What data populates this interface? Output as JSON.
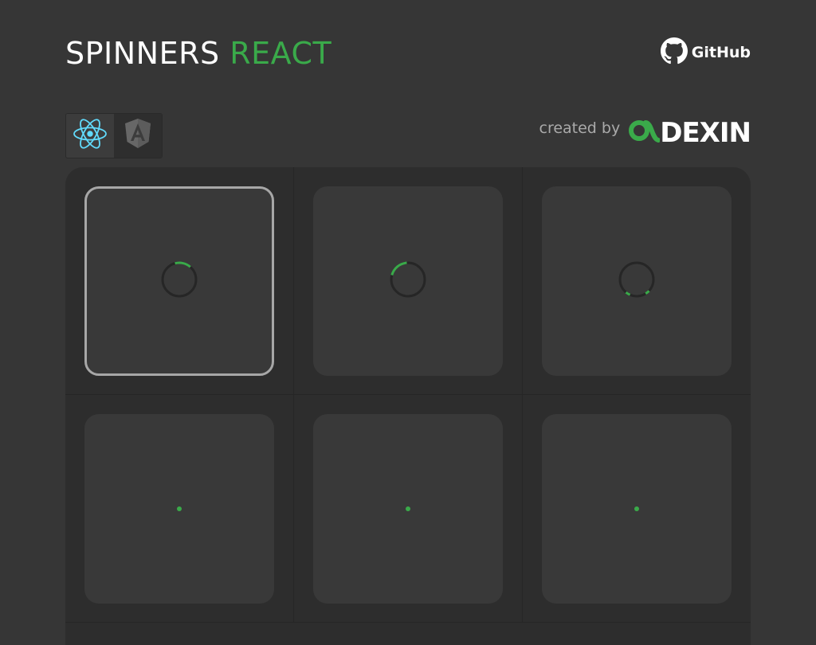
{
  "header": {
    "title_main": "SPINNERS",
    "title_accent": "REACT",
    "github_label": "GitHub"
  },
  "frameworks": [
    {
      "name": "React",
      "icon": "react-icon",
      "active": true
    },
    {
      "name": "Angular",
      "icon": "angular-icon",
      "active": false
    }
  ],
  "credit": {
    "label": "created by",
    "brand_text": "DEXIN"
  },
  "colors": {
    "background": "#363636",
    "accent": "#3aaa4a",
    "tile": "#393939",
    "grid": "#2d2d2d",
    "react_logo": "#61dafb"
  },
  "spinners": [
    {
      "id": 1,
      "kind": "circle-arc",
      "selected": true
    },
    {
      "id": 2,
      "kind": "circle-arc",
      "selected": false
    },
    {
      "id": 3,
      "kind": "circle-dual-arc",
      "selected": false
    },
    {
      "id": 4,
      "kind": "dot",
      "selected": false
    },
    {
      "id": 5,
      "kind": "dot",
      "selected": false
    },
    {
      "id": 6,
      "kind": "dot",
      "selected": false
    }
  ]
}
